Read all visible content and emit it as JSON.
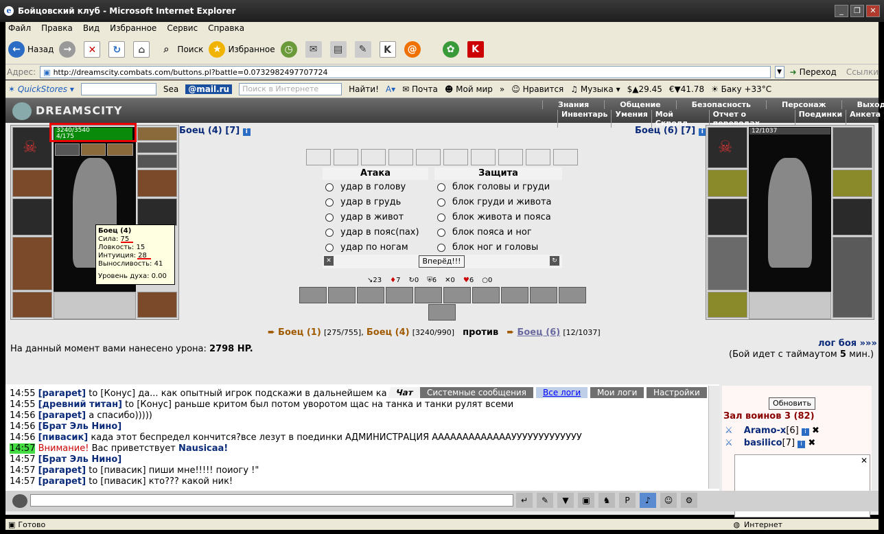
{
  "window": {
    "title": "Бойцовский клуб - Microsoft Internet Explorer",
    "min": "_",
    "max": "❐",
    "close": "✕"
  },
  "menu": [
    "Файл",
    "Правка",
    "Вид",
    "Избранное",
    "Сервис",
    "Справка"
  ],
  "toolbar": {
    "back": "Назад",
    "search": "Поиск",
    "favorites": "Избранное"
  },
  "address": {
    "label": "Адрес:",
    "url": "http://dreamscity.combats.com/buttons.pl?battle=0.0732982497707724",
    "go": "Переход",
    "links": "Ссылки"
  },
  "linkbar": {
    "quickstores": "QuickStores",
    "search_short": "Sea",
    "mailru": "@mail.ru",
    "search_placeholder": "Поиск в Интернете",
    "find": "Найти!",
    "mail": "Почта",
    "myworld": "Мой мир",
    "like": "Нравится",
    "music": "Музыка",
    "money1": "29.45",
    "money2": "41.78",
    "weather": "Баку +33°C"
  },
  "site": {
    "logo": "DREAMSCITY",
    "nav_top": [
      "Знания",
      "Общение",
      "Безопасность",
      "Персонаж",
      "Выход"
    ],
    "nav_bottom": [
      "Инвентарь",
      "Умения",
      "Мой Скролл",
      "Отчет о переводах",
      "Поединки",
      "Анкета"
    ]
  },
  "left_fighter": {
    "name": "Боец (4) [7]",
    "hp": "3240/3540",
    "mana": "4/175",
    "tooltip": {
      "title": "Боец (4)",
      "str": "Сила: 75",
      "agi": "Ловкость: 15",
      "int": "Интуиция: 28",
      "end": "Выносливость: 41",
      "spirit": "Уровень духа: 0.00"
    }
  },
  "right_fighter": {
    "name": "Боец (6) [7]",
    "hp": "12/1037"
  },
  "attack": {
    "header": "Атака",
    "options": [
      "удар в голову",
      "удар в грудь",
      "удар в живот",
      "удар в пояс(пах)",
      "удар по ногам"
    ]
  },
  "defense": {
    "header": "Защита",
    "options": [
      "блок головы и груди",
      "блок груди и живота",
      "блок живота и пояса",
      "блок пояса и ног",
      "блок ног и головы"
    ]
  },
  "forward_btn": "Вперёд!!!",
  "counters": [
    "23",
    "7",
    "0",
    "6",
    "0",
    "6",
    "0"
  ],
  "battle": {
    "f1": "Боец (1)",
    "f1_hp": "[275/755],",
    "f4": "Боец (4)",
    "f4_hp": "[3240/990]",
    "vs": "против",
    "f6": "Боец (6)",
    "f6_hp": "[12/1037]",
    "damage_label": "На данный момент вами нанесено урона:",
    "damage_value": "2798 HP.",
    "log": "лог боя »»»",
    "timeout_prefix": "(Бой идет с таймаутом",
    "timeout_value": "5",
    "timeout_suffix": "мин.)"
  },
  "chat": {
    "tabs": [
      "Чат",
      "Системные сообщения",
      "Все логи",
      "Мои логи",
      "Настройки"
    ],
    "lines": [
      {
        "time": "14:55",
        "nick": "[parapet]",
        "text": "to [Конус] да... как опытный игрок подскажи в дальнейшем ка"
      },
      {
        "time": "14:55",
        "nick": "[древний титан]",
        "text": "to [Конус] раньше критом был потом уворотом щас на танка и танки рулят всеми"
      },
      {
        "time": "14:56",
        "nick": "[parapet]",
        "text": "а спасибо)))))"
      },
      {
        "time": "14:56",
        "nick": "[Брат Эль Нино]",
        "text": ""
      },
      {
        "time": "14:56",
        "nick": "[пивасик]",
        "text": "када этот беспредел кончится?все лезут в поединки АДМИНИСТРАЦИЯ АААААААААААААУУУУУУУУУУУУУ"
      },
      {
        "time": "14:57",
        "nick": "Внимание!",
        "text": "Вас приветствует",
        "extra": "Nausicaa!"
      },
      {
        "time": "14:57",
        "nick": "[Брат Эль Нино]",
        "text": ""
      },
      {
        "time": "14:57",
        "nick": "[parapet]",
        "text": "to [пивасик] пиши мне!!!!! поиогу !\""
      },
      {
        "time": "14:57",
        "nick": "[parapet]",
        "text": "to [пивасик] кто??? какой ник!"
      }
    ]
  },
  "sidebar": {
    "refresh": "Обновить",
    "room": "Зал воинов 3 (82)",
    "users": [
      {
        "name": "Aramo-x",
        "level": "[6]"
      },
      {
        "name": "basilico",
        "level": "[7]"
      }
    ]
  },
  "statusbar": {
    "ready": "Готово",
    "zone": "Интернет"
  },
  "colors": {
    "accent": "#a05a00",
    "hp": "#0a8a0a",
    "chat_time_hl": "#44dd44"
  }
}
